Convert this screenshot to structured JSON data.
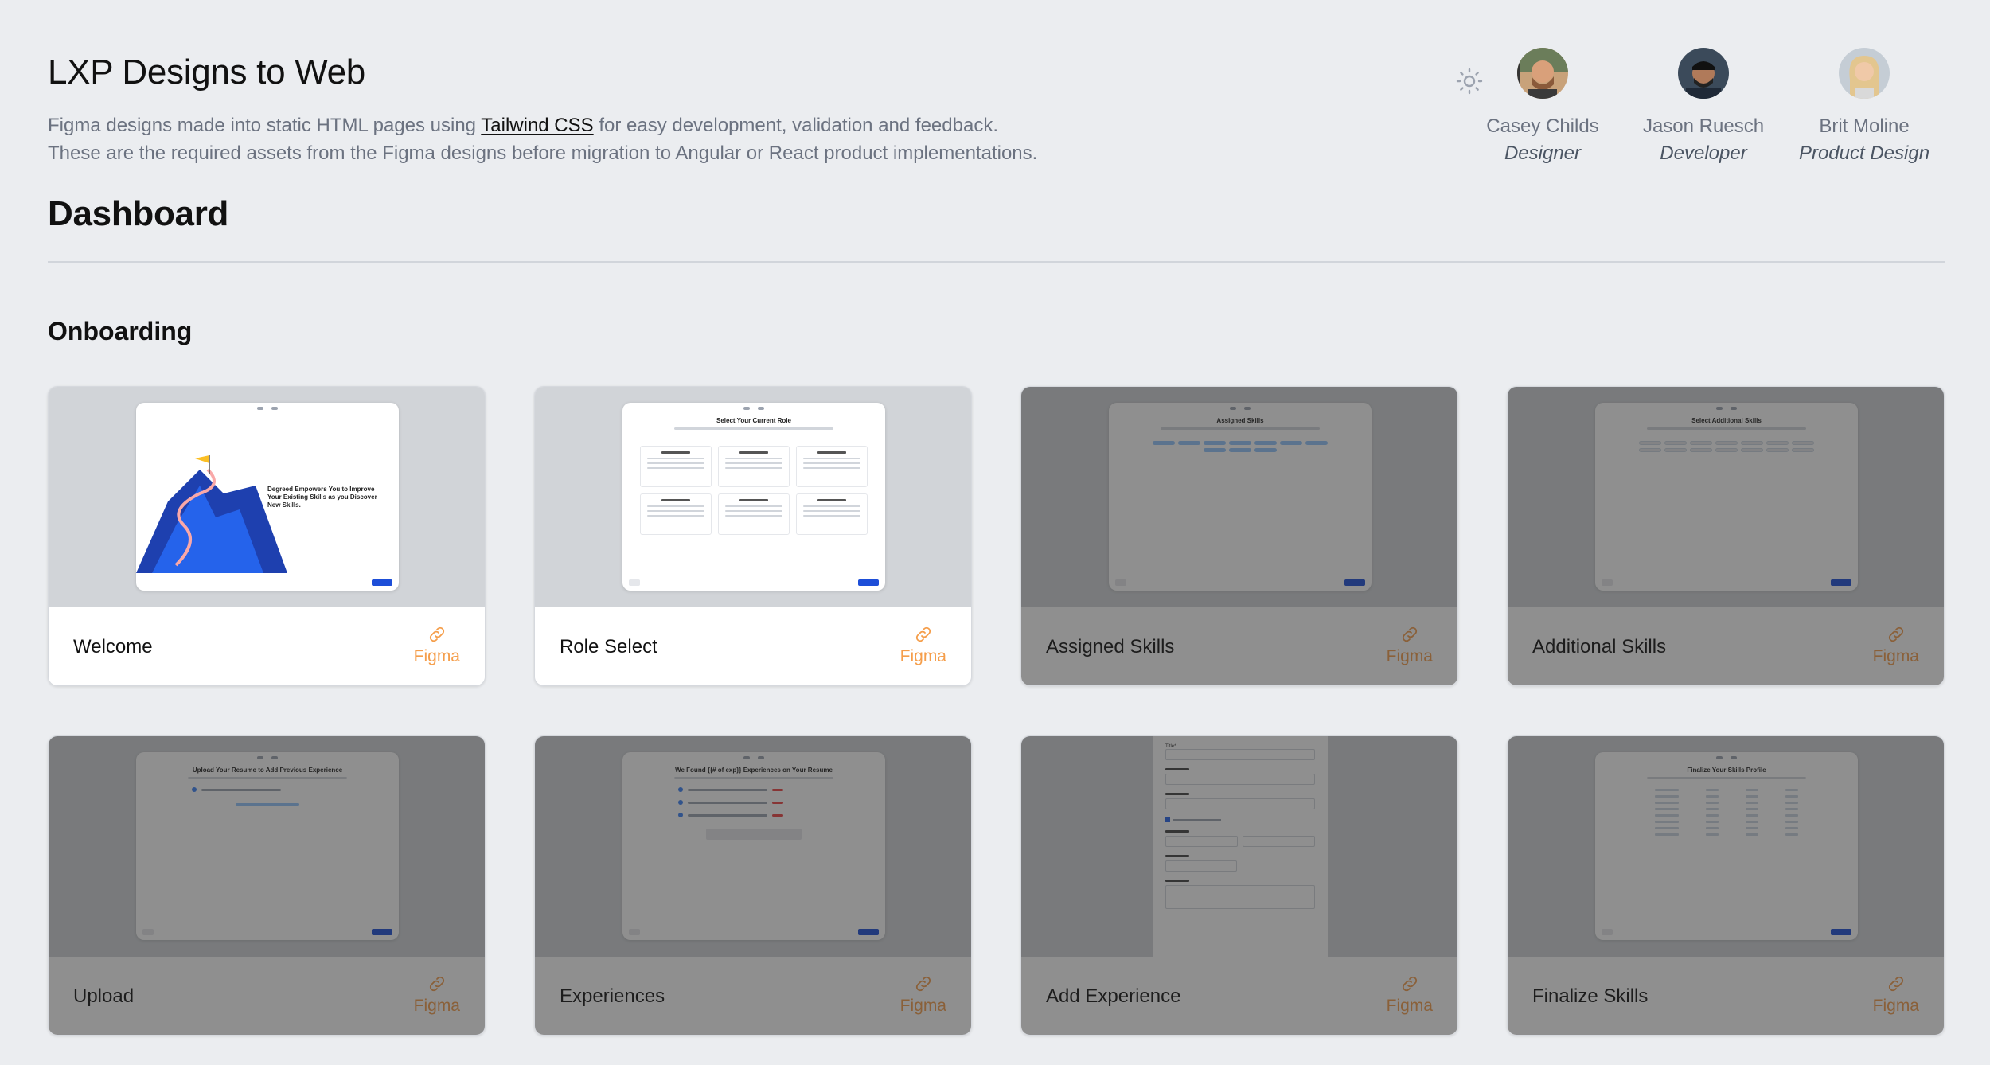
{
  "header": {
    "title": "LXP Designs to Web",
    "desc_prefix": "Figma designs made into static HTML pages using ",
    "desc_link": "Tailwind CSS",
    "desc_suffix": " for easy development, validation and feedback.",
    "desc_line2": "These are the required assets from the Figma designs before migration to Angular or React product implementations.",
    "theme_icon": "sun-icon"
  },
  "team": [
    {
      "name": "Casey Childs",
      "role": "Designer"
    },
    {
      "name": "Jason Ruesch",
      "role": "Developer"
    },
    {
      "name": "Brit Moline",
      "role": "Product Design"
    }
  ],
  "dashboard": {
    "title": "Dashboard",
    "section": "Onboarding"
  },
  "figma_label": "Figma",
  "cards": [
    {
      "label": "Welcome",
      "preview_heading": "Degreed Empowers You to Improve Your Existing Skills as you Discover New Skills."
    },
    {
      "label": "Role Select",
      "preview_heading": "Select Your Current Role"
    },
    {
      "label": "Assigned Skills",
      "preview_heading": "Assigned Skills"
    },
    {
      "label": "Additional Skills",
      "preview_heading": "Select Additional Skills"
    },
    {
      "label": "Upload",
      "preview_heading": "Upload Your Resume to Add Previous Experience"
    },
    {
      "label": "Experiences",
      "preview_heading": "We Found {{# of exp}} Experiences on Your Resume"
    },
    {
      "label": "Add Experience",
      "preview_heading": "Title*"
    },
    {
      "label": "Finalize Skills",
      "preview_heading": "Finalize Your Skills Profile"
    }
  ],
  "colors": {
    "background": "#ebedf0",
    "accent_link": "#f59e4b",
    "primary_button": "#1d4ed8"
  }
}
